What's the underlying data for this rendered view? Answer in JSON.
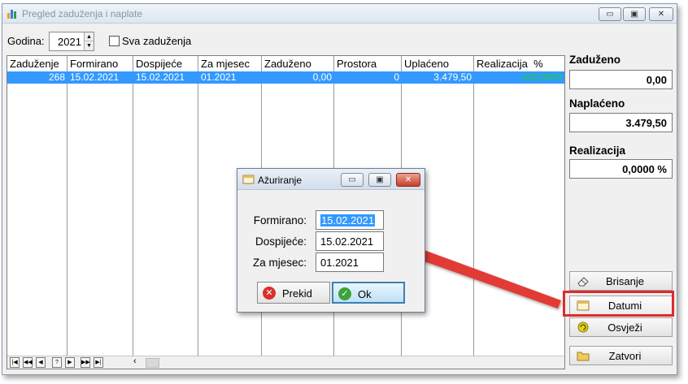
{
  "window": {
    "title": "Pregled zaduženja i naplate"
  },
  "filter": {
    "year_label": "Godina:",
    "year_value": "2021",
    "all_label": "Sva zaduženja"
  },
  "grid": {
    "headers": [
      "Zaduženje",
      "Formirano",
      "Dospijeće",
      "Za mjesec",
      "Zaduženo",
      "Prostora",
      "Uplaćeno",
      "Realizacija  %"
    ],
    "rows": [
      [
        "268",
        "15.02.2021",
        "15.02.2021",
        "01.2021",
        "0,00",
        "0",
        "3.479,50",
        "100,0000"
      ]
    ]
  },
  "side": {
    "zaduzeno_label": "Zaduženo",
    "zaduzeno_value": "0,00",
    "naplaceno_label": "Naplaćeno",
    "naplaceno_value": "3.479,50",
    "realizacija_label": "Realizacija",
    "realizacija_value": "0,0000 %",
    "btn_brisanje": "Brisanje",
    "btn_datumi": "Datumi",
    "btn_osvjezi": "Osvježi",
    "btn_zatvori": "Zatvori"
  },
  "dialog": {
    "title": "Ažuriranje",
    "formirano_label": "Formirano:",
    "formirano_value": "15.02.2021",
    "dospijece_label": "Dospijeće:",
    "dospijece_value": "15.02.2021",
    "zamjesec_label": "Za mjesec:",
    "zamjesec_value": "01.2021",
    "cancel_label": "Prekid",
    "ok_label": "Ok"
  },
  "colors": {
    "selection": "#3399ff",
    "realizacija_text": "#22cc44",
    "annotation": "#e12a2a"
  }
}
